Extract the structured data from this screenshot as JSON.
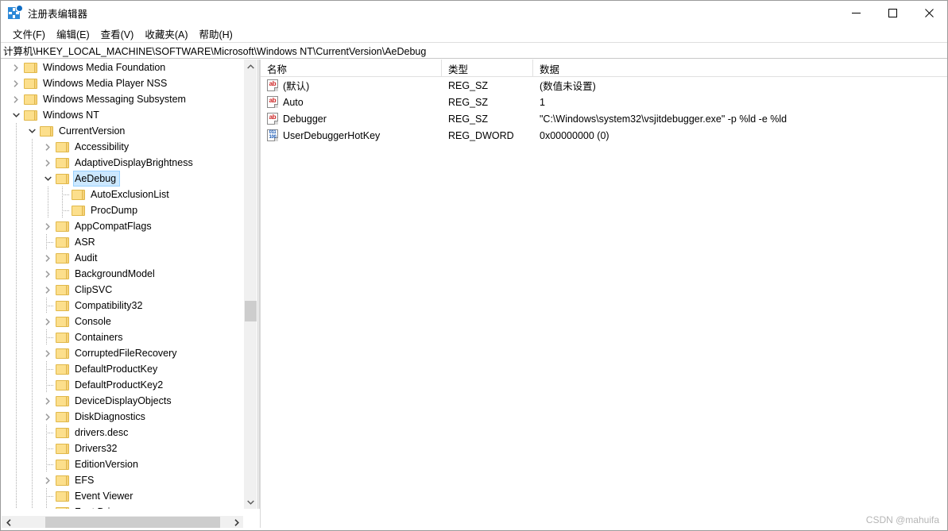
{
  "window": {
    "title": "注册表编辑器",
    "app_icon": "registry-editor-icon",
    "minimize_label": "—",
    "maximize_label": "□",
    "close_label": "✕"
  },
  "menubar": {
    "items": [
      {
        "label": "文件(F)",
        "name": "menu-file"
      },
      {
        "label": "编辑(E)",
        "name": "menu-edit"
      },
      {
        "label": "查看(V)",
        "name": "menu-view"
      },
      {
        "label": "收藏夹(A)",
        "name": "menu-favorites"
      },
      {
        "label": "帮助(H)",
        "name": "menu-help"
      }
    ]
  },
  "address": {
    "path": "计算机\\HKEY_LOCAL_MACHINE\\SOFTWARE\\Microsoft\\Windows NT\\CurrentVersion\\AeDebug"
  },
  "tree": {
    "items": [
      {
        "label": "Windows Media Foundation",
        "depth": 1,
        "state": "collapsed",
        "selected": false
      },
      {
        "label": "Windows Media Player NSS",
        "depth": 1,
        "state": "collapsed",
        "selected": false
      },
      {
        "label": "Windows Messaging Subsystem",
        "depth": 1,
        "state": "collapsed",
        "selected": false
      },
      {
        "label": "Windows NT",
        "depth": 1,
        "state": "expanded",
        "selected": false
      },
      {
        "label": "CurrentVersion",
        "depth": 2,
        "state": "expanded",
        "selected": false
      },
      {
        "label": "Accessibility",
        "depth": 3,
        "state": "collapsed",
        "selected": false
      },
      {
        "label": "AdaptiveDisplayBrightness",
        "depth": 3,
        "state": "collapsed",
        "selected": false
      },
      {
        "label": "AeDebug",
        "depth": 3,
        "state": "expanded",
        "selected": true
      },
      {
        "label": "AutoExclusionList",
        "depth": 4,
        "state": "leaf",
        "selected": false
      },
      {
        "label": "ProcDump",
        "depth": 4,
        "state": "leaf",
        "selected": false
      },
      {
        "label": "AppCompatFlags",
        "depth": 3,
        "state": "collapsed",
        "selected": false
      },
      {
        "label": "ASR",
        "depth": 3,
        "state": "leaf",
        "selected": false
      },
      {
        "label": "Audit",
        "depth": 3,
        "state": "collapsed",
        "selected": false
      },
      {
        "label": "BackgroundModel",
        "depth": 3,
        "state": "collapsed",
        "selected": false
      },
      {
        "label": "ClipSVC",
        "depth": 3,
        "state": "collapsed",
        "selected": false
      },
      {
        "label": "Compatibility32",
        "depth": 3,
        "state": "leaf",
        "selected": false
      },
      {
        "label": "Console",
        "depth": 3,
        "state": "collapsed",
        "selected": false
      },
      {
        "label": "Containers",
        "depth": 3,
        "state": "leaf",
        "selected": false
      },
      {
        "label": "CorruptedFileRecovery",
        "depth": 3,
        "state": "collapsed",
        "selected": false
      },
      {
        "label": "DefaultProductKey",
        "depth": 3,
        "state": "leaf",
        "selected": false
      },
      {
        "label": "DefaultProductKey2",
        "depth": 3,
        "state": "leaf",
        "selected": false
      },
      {
        "label": "DeviceDisplayObjects",
        "depth": 3,
        "state": "collapsed",
        "selected": false
      },
      {
        "label": "DiskDiagnostics",
        "depth": 3,
        "state": "collapsed",
        "selected": false
      },
      {
        "label": "drivers.desc",
        "depth": 3,
        "state": "leaf",
        "selected": false
      },
      {
        "label": "Drivers32",
        "depth": 3,
        "state": "leaf",
        "selected": false
      },
      {
        "label": "EditionVersion",
        "depth": 3,
        "state": "leaf",
        "selected": false
      },
      {
        "label": "EFS",
        "depth": 3,
        "state": "collapsed",
        "selected": false
      },
      {
        "label": "Event Viewer",
        "depth": 3,
        "state": "leaf",
        "selected": false
      },
      {
        "label": "Font Drivers",
        "depth": 3,
        "state": "leaf",
        "selected": false
      }
    ],
    "selection_color": "#cce8ff",
    "folder_color": "#fcdf8c"
  },
  "list": {
    "columns": [
      "名称",
      "类型",
      "数据"
    ],
    "rows": [
      {
        "name": "(默认)",
        "type": "REG_SZ",
        "data": "(数值未设置)",
        "icon": "string-value-icon"
      },
      {
        "name": "Auto",
        "type": "REG_SZ",
        "data": "1",
        "icon": "string-value-icon"
      },
      {
        "name": "Debugger",
        "type": "REG_SZ",
        "data": "\"C:\\Windows\\system32\\vsjitdebugger.exe\" -p %ld -e %ld",
        "icon": "string-value-icon"
      },
      {
        "name": "UserDebuggerHotKey",
        "type": "REG_DWORD",
        "data": "0x00000000 (0)",
        "icon": "dword-value-icon"
      }
    ]
  },
  "icons": {
    "string_glyph": "ab",
    "dword_glyph_top": "011",
    "dword_glyph_bottom": "100"
  },
  "watermark": {
    "text": "CSDN @mahuifa"
  }
}
